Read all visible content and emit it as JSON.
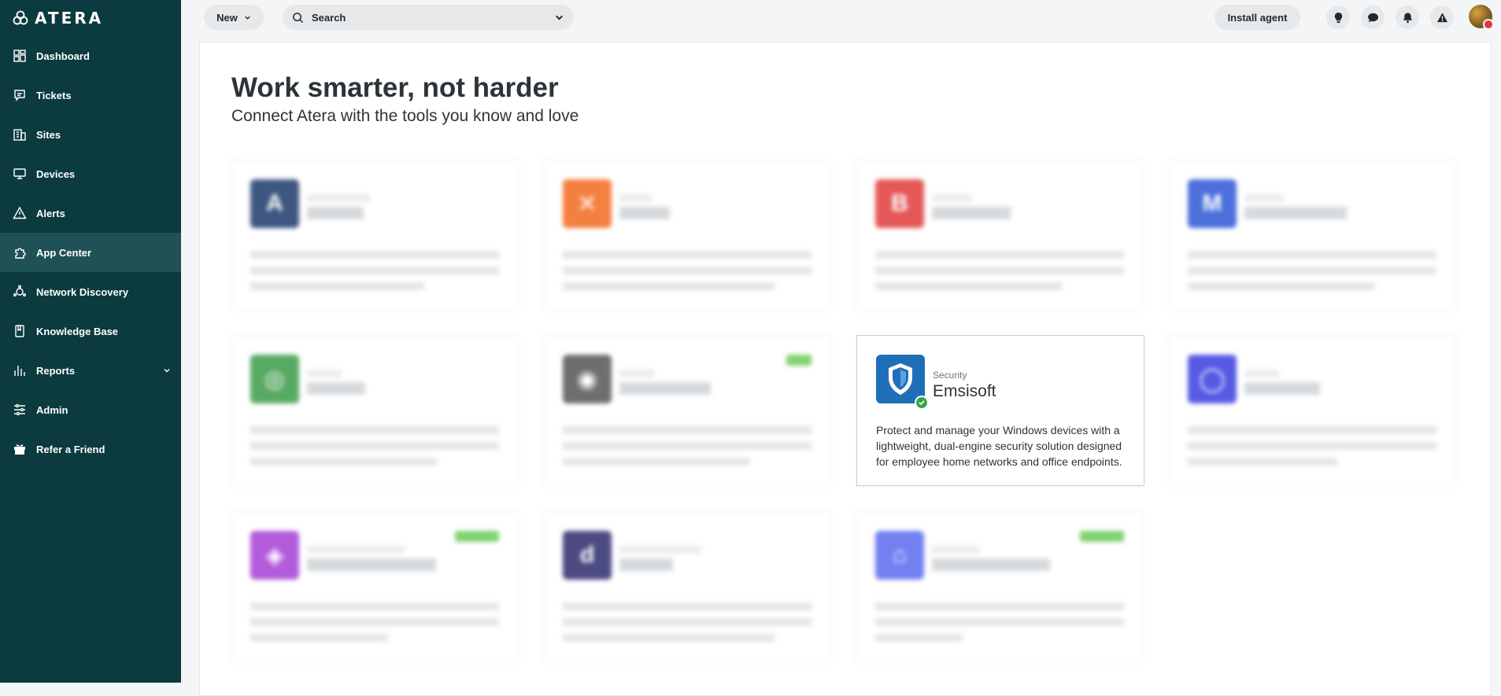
{
  "app": {
    "logo_text": "ATERA"
  },
  "sidebar": {
    "items": [
      {
        "label": "Dashboard",
        "icon": "dashboard-icon"
      },
      {
        "label": "Tickets",
        "icon": "tickets-icon"
      },
      {
        "label": "Sites",
        "icon": "sites-icon"
      },
      {
        "label": "Devices",
        "icon": "devices-icon"
      },
      {
        "label": "Alerts",
        "icon": "alerts-icon"
      },
      {
        "label": "App Center",
        "icon": "app-center-icon",
        "active": true
      },
      {
        "label": "Network Discovery",
        "icon": "network-discovery-icon"
      },
      {
        "label": "Knowledge Base",
        "icon": "knowledge-base-icon"
      },
      {
        "label": "Reports",
        "icon": "reports-icon",
        "has_chevron": true
      },
      {
        "label": "Admin",
        "icon": "admin-icon"
      },
      {
        "label": "Refer a Friend",
        "icon": "gift-icon"
      }
    ]
  },
  "topbar": {
    "new_label": "New",
    "search_placeholder": "Search",
    "install_agent_label": "Install agent",
    "icons": [
      "lightbulb-icon",
      "chat-icon",
      "bell-icon",
      "warning-icon"
    ]
  },
  "main": {
    "title": "Work smarter, not harder",
    "subtitle": "Connect Atera with the tools you know and love",
    "focused_app": {
      "category": "Security",
      "name": "Emsisoft",
      "description": "Protect and manage your Windows devices with a lightweight, dual-engine security solution designed for employee home networks and office endpoints."
    }
  },
  "colors": {
    "sidebar_bg": "#0b3a3f",
    "sidebar_active": "#1f5156",
    "emsisoft_blue": "#1f6fb8",
    "badge_green": "#6bcb5a"
  }
}
